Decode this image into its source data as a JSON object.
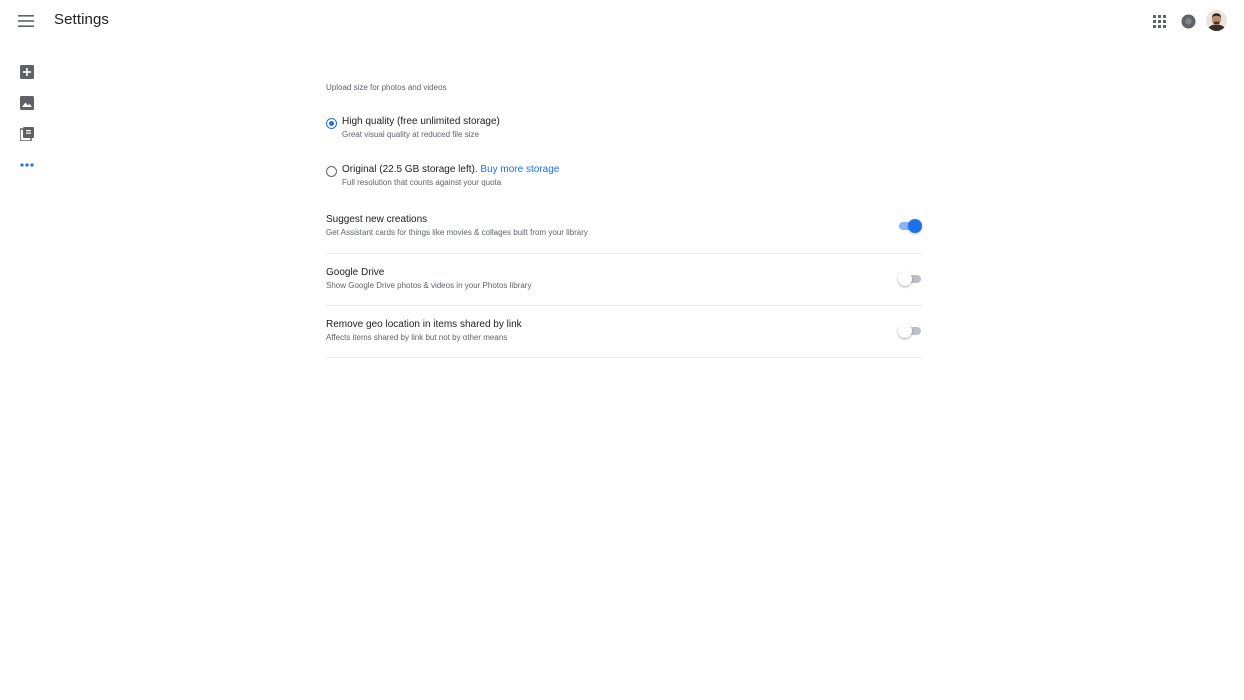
{
  "header": {
    "title": "Settings",
    "icons": {
      "menu": "menu-icon",
      "apps": "apps-grid-icon",
      "notifications": "notifications-icon",
      "avatar": "avatar"
    }
  },
  "sidebar": {
    "items": [
      {
        "icon": "add-photo-icon",
        "active": false
      },
      {
        "icon": "photos-icon",
        "active": false
      },
      {
        "icon": "library-icon",
        "active": false
      },
      {
        "icon": "more-horiz-icon",
        "active": true
      }
    ],
    "active_color": "#1a73e8"
  },
  "upload": {
    "section_title": "Upload size for photos and videos",
    "options": [
      {
        "label": "High quality (free unlimited storage)",
        "sub": "Great visual quality at reduced file size",
        "checked": true
      },
      {
        "label": "Original (22.5 GB storage left).",
        "link": "Buy more storage",
        "sub": "Full resolution that counts against your quota",
        "checked": false
      }
    ]
  },
  "settings": [
    {
      "title": "Suggest new creations",
      "sub": "Get Assistant cards for things like movies & collages built from your library",
      "enabled": true
    },
    {
      "title": "Google Drive",
      "sub": "Show Google Drive photos & videos in your Photos library",
      "enabled": false
    },
    {
      "title": "Remove geo location in items shared by link",
      "sub": "Affects items shared by link but not by other means",
      "enabled": false
    }
  ],
  "colors": {
    "accent": "#1a73e8",
    "toggle_track_on": "#8ab4f8",
    "toggle_track_off": "#bdc1c6",
    "text_secondary": "#5f6368"
  }
}
